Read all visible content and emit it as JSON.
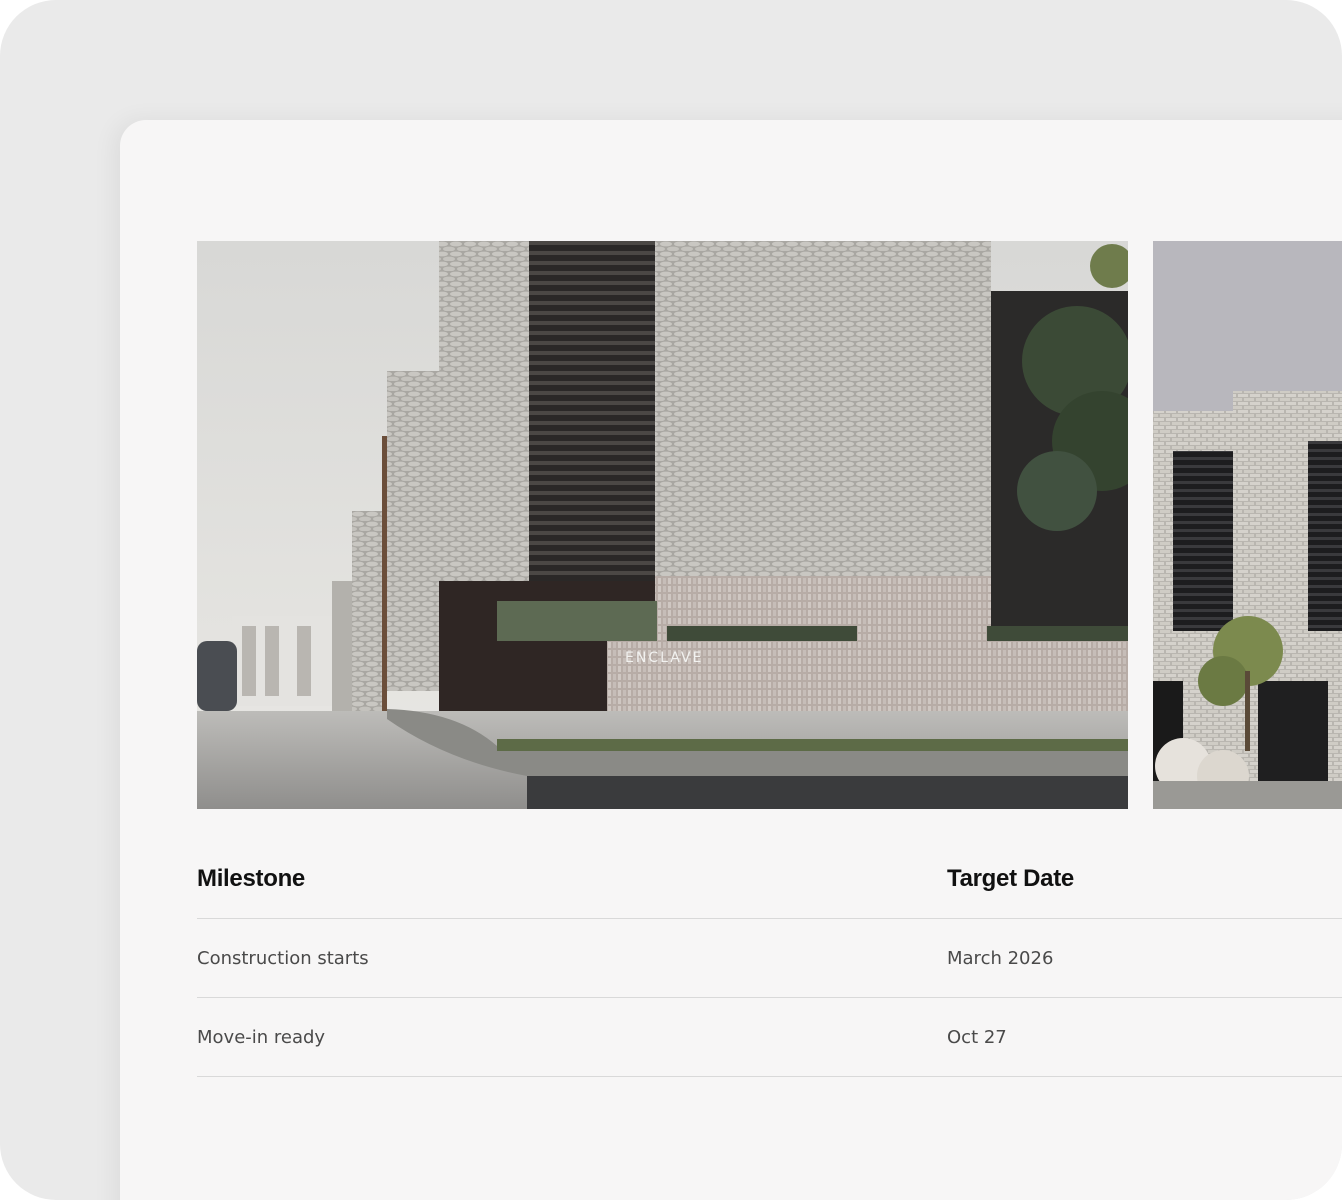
{
  "gallery": {
    "main_image_sign_text": "ENCLAVE",
    "images": [
      {
        "name": "building-exterior-render-1"
      },
      {
        "name": "building-exterior-render-2"
      }
    ]
  },
  "table": {
    "headers": {
      "milestone": "Milestone",
      "target_date": "Target Date"
    },
    "rows": [
      {
        "milestone": "Construction starts",
        "target_date": "March 2026"
      },
      {
        "milestone": "Move-in ready",
        "target_date": "Oct 27"
      }
    ]
  },
  "colors": {
    "background": "#eaeaea",
    "card": "#f7f6f6",
    "divider": "#d9d9d9",
    "heading_text": "#111111",
    "body_text": "#4a4a4a"
  }
}
